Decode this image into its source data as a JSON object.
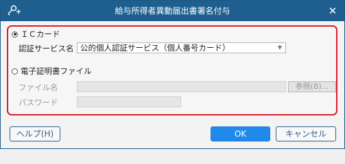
{
  "dialog": {
    "title": "給与所得者異動届出書署名付与",
    "close_glyph": "✕"
  },
  "ic_card": {
    "radio_label": "ＩＣカード",
    "selected": true,
    "service_label": "認証サービス名",
    "service_value": "公的個人認証サービス（個人番号カード）"
  },
  "cert_file": {
    "radio_label": "電子証明書ファイル",
    "selected": false,
    "file_label": "ファイル名",
    "file_value": "",
    "browse_label": "参照(B)...",
    "password_label": "パスワード",
    "password_value": ""
  },
  "footer": {
    "help_label": "ヘルプ(H)",
    "ok_label": "OK",
    "cancel_label": "キャンセル"
  },
  "colors": {
    "titlebar": "#1e5f8f",
    "highlight_border": "#d81e28",
    "primary_button": "#1f8ae9"
  },
  "icons": {
    "title": "key-plus-icon",
    "dropdown": "chevron-down-icon"
  }
}
